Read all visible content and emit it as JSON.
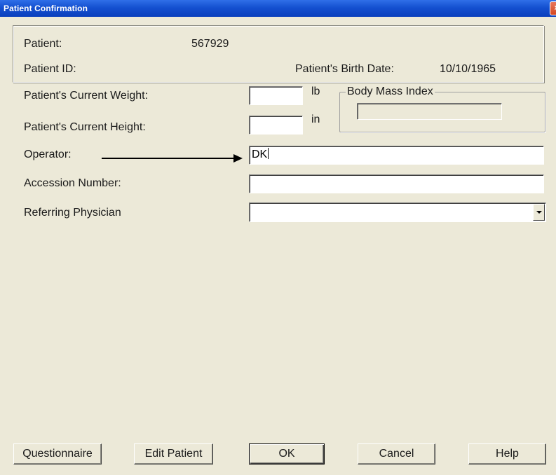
{
  "window": {
    "title": "Patient Confirmation",
    "close_glyph": "×"
  },
  "info": {
    "patient_label": "Patient:",
    "patient_value": "567929",
    "patient_id_label": "Patient ID:",
    "patient_id_value": "",
    "birth_date_label": "Patient's Birth Date:",
    "birth_date_value": "10/10/1965"
  },
  "form": {
    "weight_label": "Patient's Current Weight:",
    "weight_value": "",
    "weight_unit": "lb",
    "height_label": "Patient's Current Height:",
    "height_value": "",
    "height_unit": "in",
    "bmi_label": "Body Mass Index",
    "bmi_value": "",
    "operator_label": "Operator:",
    "operator_value": "DK",
    "accession_label": "Accession Number:",
    "accession_value": "",
    "physician_label": "Referring Physician",
    "physician_value": ""
  },
  "buttons": {
    "questionnaire": "Questionnaire",
    "edit_patient": "Edit Patient",
    "ok": "OK",
    "cancel": "Cancel",
    "help": "Help"
  },
  "icons": {
    "close": "close-icon",
    "dropdown": "chevron-down-icon",
    "annotation": "arrow-right-icon"
  },
  "colors": {
    "titlebar": "#1450d0",
    "window_bg": "#ece9d8",
    "close_button": "#d4461f"
  }
}
